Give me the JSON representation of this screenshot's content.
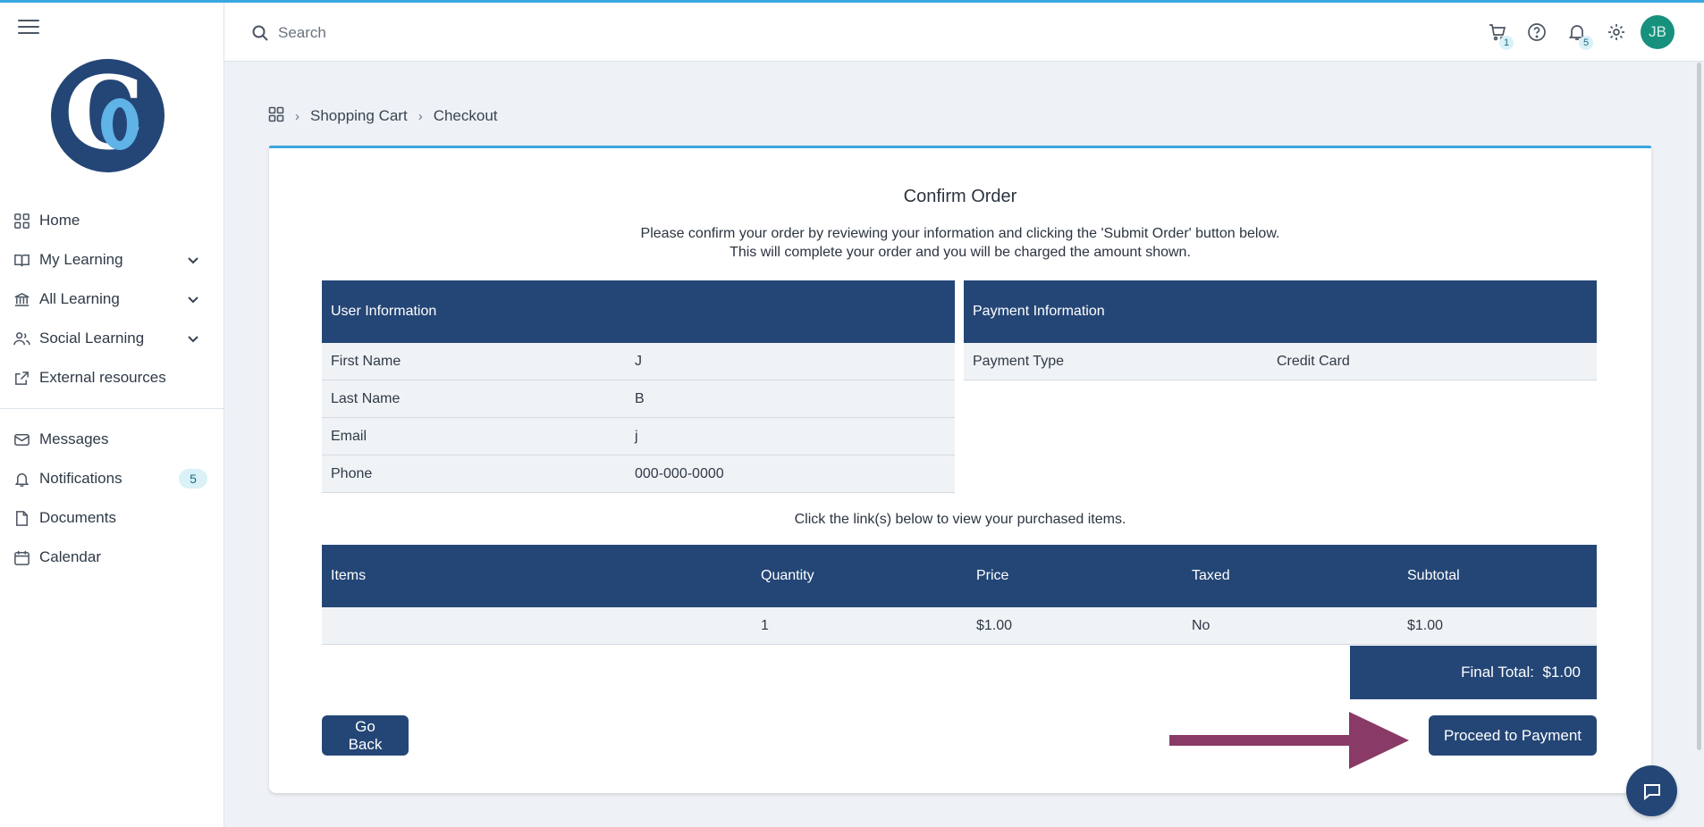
{
  "search": {
    "placeholder": "Search"
  },
  "header": {
    "cart_count": "1",
    "notification_count": "5",
    "avatar_initials": "JB"
  },
  "sidebar": {
    "items": [
      {
        "label": "Home",
        "icon": "grid-icon"
      },
      {
        "label": "My Learning",
        "icon": "book-icon",
        "expandable": true
      },
      {
        "label": "All Learning",
        "icon": "bank-icon",
        "expandable": true
      },
      {
        "label": "Social Learning",
        "icon": "users-icon",
        "expandable": true
      },
      {
        "label": "External resources",
        "icon": "external-link-icon"
      }
    ],
    "secondary": [
      {
        "label": "Messages",
        "icon": "mail-icon"
      },
      {
        "label": "Notifications",
        "icon": "bell-icon",
        "badge": "5"
      },
      {
        "label": "Documents",
        "icon": "document-icon"
      },
      {
        "label": "Calendar",
        "icon": "calendar-icon"
      }
    ]
  },
  "breadcrumb": {
    "items": [
      "Shopping Cart",
      "Checkout"
    ]
  },
  "order": {
    "title": "Confirm Order",
    "subtitle_line1": "Please confirm your order by reviewing your information and clicking the 'Submit Order' button below.",
    "subtitle_line2": "This will complete your order and you will be charged the amount shown.",
    "user_info": {
      "heading": "User Information",
      "rows": [
        {
          "label": "First Name",
          "value": "J"
        },
        {
          "label": "Last Name",
          "value": "B"
        },
        {
          "label": "Email",
          "value": "j"
        },
        {
          "label": "Phone",
          "value": "000-000-0000"
        }
      ]
    },
    "payment_info": {
      "heading": "Payment Information",
      "rows": [
        {
          "label": "Payment Type",
          "value": "Credit Card"
        }
      ]
    },
    "items_hint": "Click the link(s) below to view your purchased items.",
    "items_table": {
      "headers": [
        "Items",
        "Quantity",
        "Price",
        "Taxed",
        "Subtotal"
      ],
      "rows": [
        {
          "item": "",
          "quantity": "1",
          "price": "$1.00",
          "taxed": "No",
          "subtotal": "$1.00"
        }
      ]
    },
    "final_total_label": "Final Total:",
    "final_total_value": "$1.00",
    "go_back_label": "Go Back",
    "proceed_label": "Proceed to Payment"
  },
  "colors": {
    "primary": "#244676",
    "accent": "#3aa7e0",
    "annotation_arrow": "#8a3a66",
    "avatar": "#17917e"
  }
}
